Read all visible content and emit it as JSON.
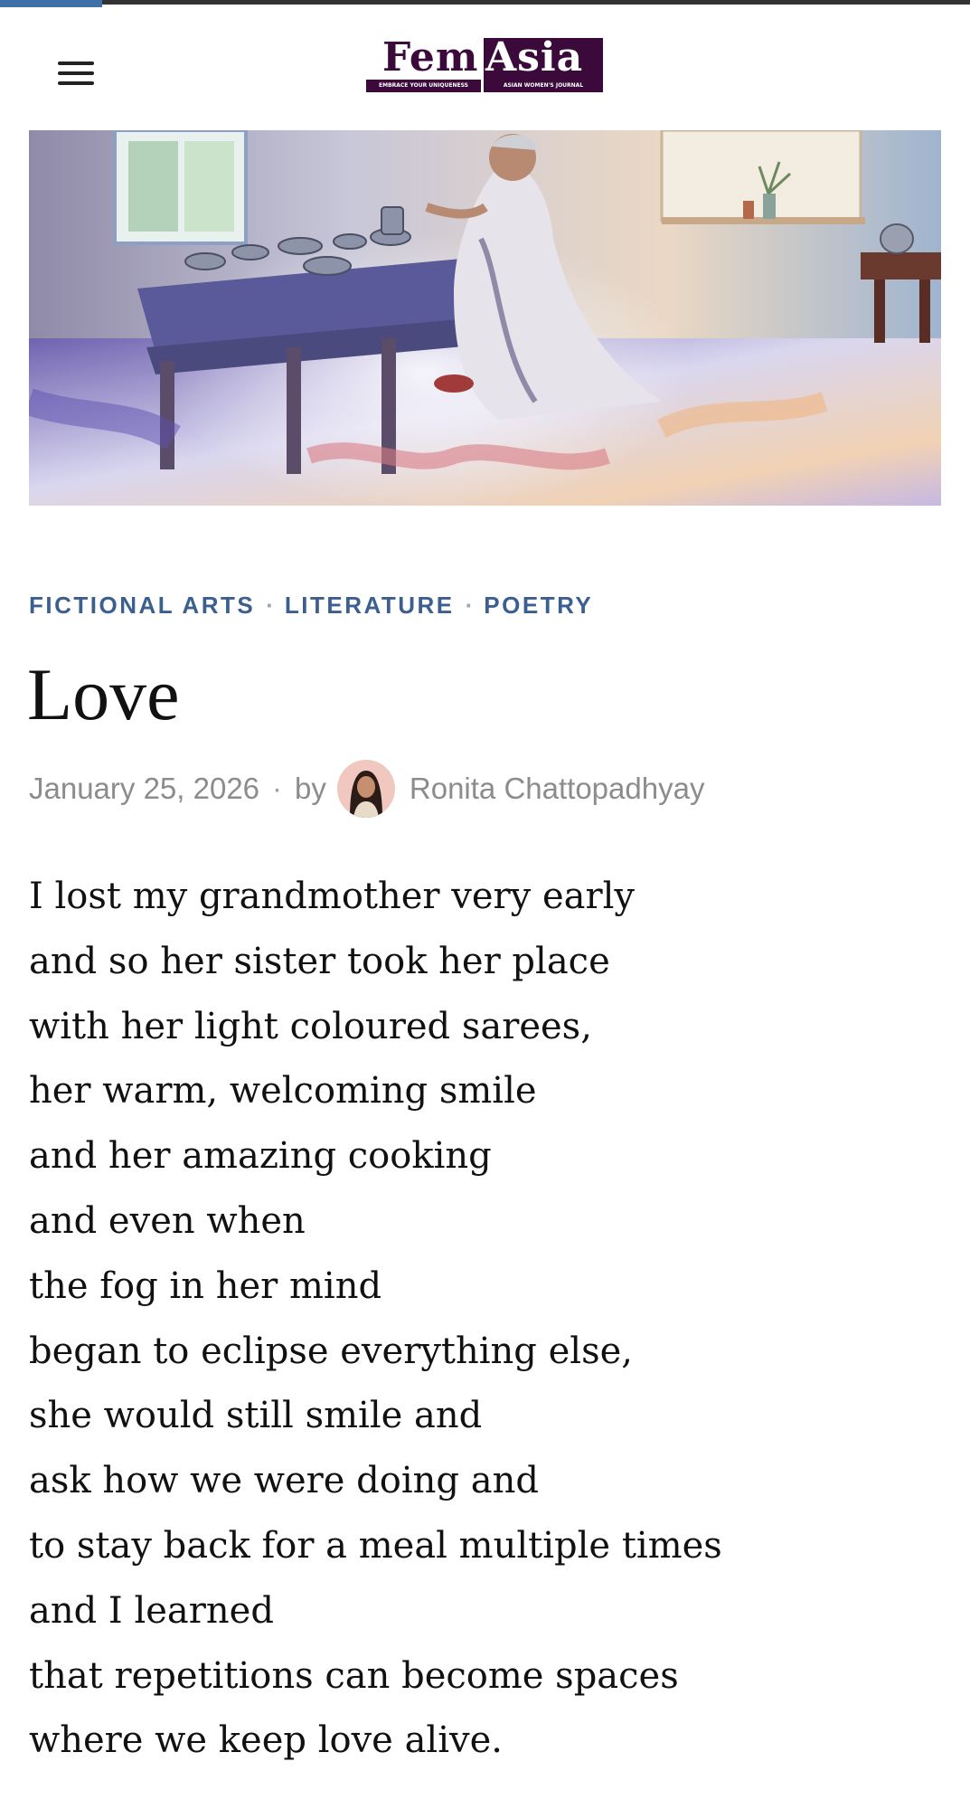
{
  "reading_progress": {
    "fraction": 0.105
  },
  "header": {
    "menu_icon": "hamburger-menu-icon",
    "logo": {
      "word_left": "Fem",
      "word_right": "Asia",
      "tagline_left": "EMBRACE YOUR UNIQUENESS",
      "tagline_right": "ASIAN WOMEN'S JOURNAL"
    }
  },
  "hero": {
    "image": "watercolor-grandmother-cooking-image"
  },
  "article": {
    "categories": [
      "FICTIONAL ARTS",
      "LITERATURE",
      "POETRY"
    ],
    "category_separator": "·",
    "title": "Love",
    "date": "January 25, 2026",
    "meta_separator": "·",
    "by_label": "by",
    "author": "Ronita Chattopadhyay",
    "poem_lines": [
      "I lost my grandmother very early",
      "and so her sister took her place",
      "with her light coloured sarees,",
      "her warm, welcoming smile",
      "and her amazing cooking",
      "and even when",
      "the fog in her mind",
      "began to eclipse everything else,",
      "she would still smile and",
      "ask how we were doing and",
      "to stay back for a meal multiple times",
      "and I learned",
      "that repetitions can become spaces",
      "where we keep love alive."
    ]
  },
  "colors": {
    "accent": "#3b5f8f",
    "logo": "#3b0a3a",
    "meta_text": "#8c8c8c",
    "progress": "#3f6fa8"
  }
}
